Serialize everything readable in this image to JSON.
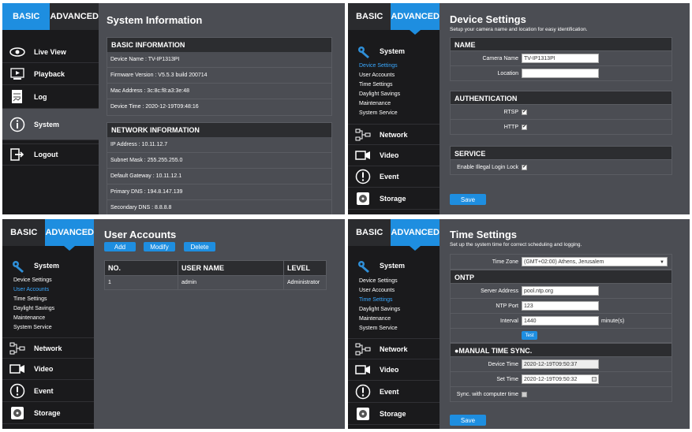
{
  "tabs": {
    "basic": "BASIC",
    "advanced": "ADVANCED"
  },
  "basic_nav": [
    {
      "label": "Live View",
      "icon": "eye-icon"
    },
    {
      "label": "Playback",
      "icon": "playback-icon"
    },
    {
      "label": "Log",
      "icon": "log-icon"
    },
    {
      "label": "System",
      "icon": "info-icon"
    },
    {
      "label": "Logout",
      "icon": "logout-icon"
    }
  ],
  "adv_nav": {
    "system": "System",
    "sub": [
      "Device Settings",
      "User Accounts",
      "Time Settings",
      "Daylight Savings",
      "Maintenance",
      "System Service"
    ],
    "network": "Network",
    "video": "Video",
    "event": "Event",
    "storage": "Storage"
  },
  "sysinfo": {
    "title": "System Information",
    "basic_head": "BASIC INFORMATION",
    "basic_rows": [
      "Device Name : TV-IP1313PI",
      "Firmware Version : V5.5.3 build 200714",
      "Mac Address : 3c:8c:f8:a3:3e:48",
      "Device Time : 2020-12-19T09:48:16"
    ],
    "net_head": "NETWORK INFORMATION",
    "net_rows": [
      "IP Address : 10.11.12.7",
      "Subnet Mask : 255.255.255.0",
      "Default Gateway : 10.11.12.1",
      "Primary DNS : 194.8.147.139",
      "Secondary DNS : 8.8.8.8"
    ]
  },
  "device": {
    "title": "Device Settings",
    "subtitle": "Setup your camera name and location for easy identification.",
    "name_head": "NAME",
    "camera_name_label": "Camera Name",
    "camera_name_value": "TV-IP1313PI",
    "location_label": "Location",
    "location_value": "",
    "auth_head": "AUTHENTICATION",
    "rtsp_label": "RTSP",
    "http_label": "HTTP",
    "service_head": "SERVICE",
    "illegal_label": "Enable Illegal Login Lock",
    "save": "Save"
  },
  "users": {
    "title": "User Accounts",
    "add": "Add",
    "modify": "Modify",
    "delete": "Delete",
    "cols": [
      "NO.",
      "USER NAME",
      "LEVEL"
    ],
    "rows": [
      [
        "1",
        "admin",
        "Administrator"
      ]
    ]
  },
  "time": {
    "title": "Time Settings",
    "subtitle": "Set up the system time for correct scheduling and logging.",
    "zone_label": "Time Zone",
    "zone_value": "(GMT+02:00) Athens, Jerusalem",
    "ntp_head": "ONTP",
    "server_label": "Server Address",
    "server_value": "pool.ntp.org",
    "port_label": "NTP Port",
    "port_value": "123",
    "interval_label": "Interval",
    "interval_value": "1440",
    "interval_unit": "minute(s)",
    "test": "Test",
    "manual_head": "●MANUAL TIME SYNC.",
    "device_time_label": "Device Time",
    "device_time_value": "2020-12-19T09:50:37",
    "set_time_label": "Set Time",
    "set_time_value": "2020-12-19T09:50:32",
    "sync_label": "Sync. with computer time",
    "save": "Save"
  }
}
